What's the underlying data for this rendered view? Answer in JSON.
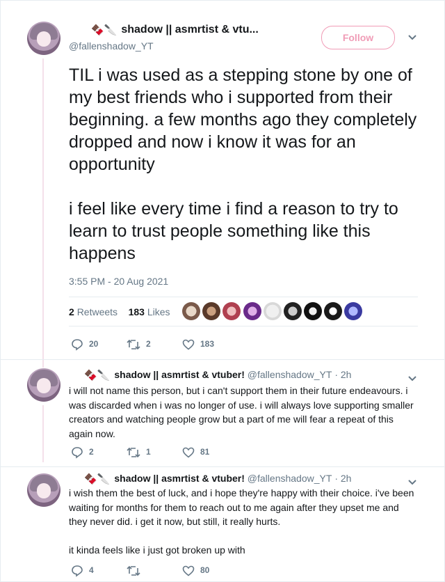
{
  "colors": {
    "brand": "#e0245e",
    "retweet": "#17bf63",
    "muted": "#657786",
    "like": "#e0245e"
  },
  "main_tweet": {
    "emoji": "🍫🔪",
    "display_name": "shadow || asmrtist & vtu...",
    "handle": "@fallenshadow_YT",
    "follow_label": "Follow",
    "text": "TIL i was used as a stepping stone by one of my best friends who i supported from their beginning. a few months ago they completely dropped and now i know it was for an opportunity\n\ni feel like every time i find a reason to try to learn to trust people something like this happens",
    "timestamp": "3:55 PM - 20 Aug 2021",
    "retweets_count": "2",
    "retweets_label": "Retweets",
    "likes_count": "183",
    "likes_label": "Likes",
    "actions": {
      "replies": "20",
      "retweets": "2",
      "likes": "183"
    }
  },
  "replies": [
    {
      "emoji": "🍫🔪",
      "display_name": "shadow || asmrtist & vtuber!",
      "handle": "@fallenshadow_YT",
      "time": "· 2h",
      "text": "i will not name this person, but i can't support them in their future endeavours. i was discarded when i was no longer of use. i will always love supporting smaller creators and watching people grow but a part of me will fear a repeat of this again now.",
      "actions": {
        "replies": "2",
        "retweets": "1",
        "likes": "81"
      }
    },
    {
      "emoji": "🍫🔪",
      "display_name": "shadow || asmrtist & vtuber!",
      "handle": "@fallenshadow_YT",
      "time": "· 2h",
      "text": "i wish them the best of luck, and i hope they're happy with their choice. i've been waiting for months for them to reach out to me again after they upset me and they never did. i get it now, but still, it really hurts.\n\nit kinda feels like i just got broken up with",
      "actions": {
        "replies": "4",
        "retweets": "",
        "likes": "80"
      }
    }
  ],
  "icons": {
    "reply": "reply-icon",
    "retweet": "retweet-icon",
    "like": "heart-icon",
    "more": "chevron-down-icon"
  }
}
